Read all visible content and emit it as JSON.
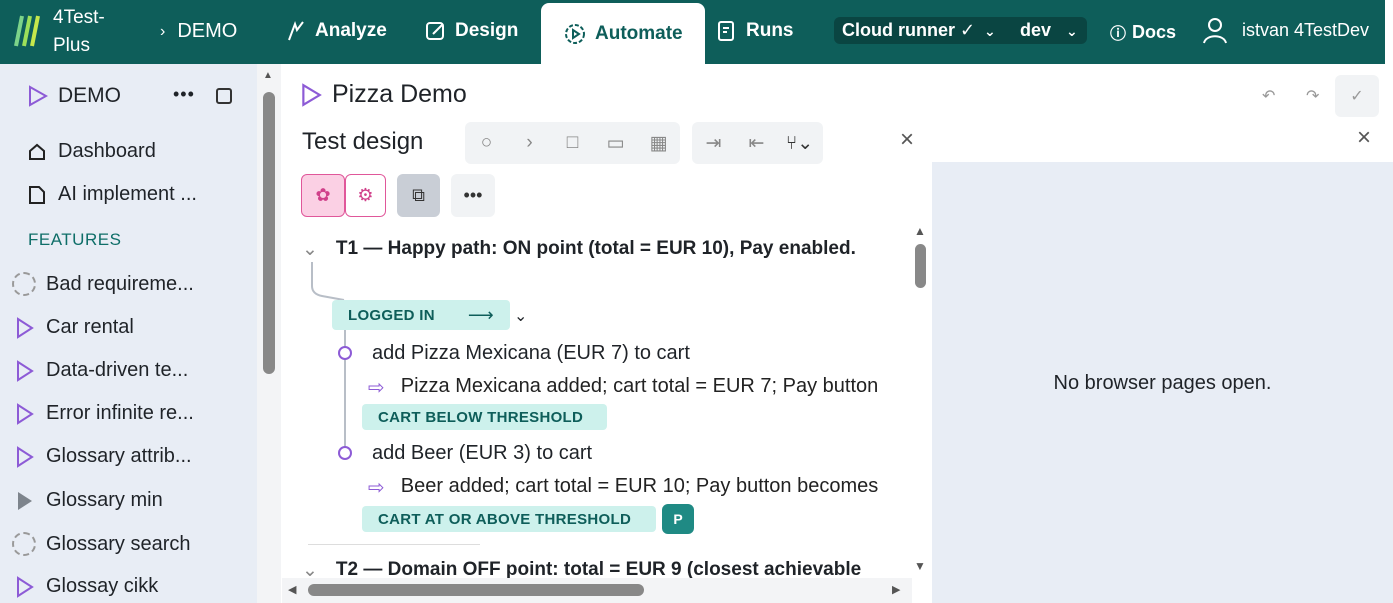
{
  "header": {
    "brand": "4Test-Plus",
    "crumb": "DEMO",
    "nav": [
      {
        "label": "Analyze",
        "icon": "analyze-icon"
      },
      {
        "label": "Design",
        "icon": "edit-icon"
      },
      {
        "label": "Automate",
        "icon": "automate-icon"
      },
      {
        "label": "Runs",
        "icon": "runs-icon"
      }
    ],
    "runner": "Cloud runner ✓",
    "env": "dev",
    "docs": "Docs",
    "user": "istvan 4TestDev"
  },
  "sidebar": {
    "project": "DEMO",
    "items": [
      "Dashboard",
      "AI implement ..."
    ],
    "section": "FEATURES",
    "features": [
      {
        "label": "Bad requireme...",
        "icon": "dashed-circle-icon"
      },
      {
        "label": "Car rental",
        "icon": "play-outline-icon"
      },
      {
        "label": "Data-driven te...",
        "icon": "play-outline-icon"
      },
      {
        "label": "Error infinite re...",
        "icon": "play-outline-icon"
      },
      {
        "label": "Glossary attrib...",
        "icon": "play-outline-icon"
      },
      {
        "label": "Glossary min",
        "icon": "play-filled-icon"
      },
      {
        "label": "Glossary search",
        "icon": "dashed-circle-icon"
      },
      {
        "label": "Glossay cikk",
        "icon": "play-outline-icon"
      }
    ]
  },
  "main": {
    "title": "Pizza Demo",
    "subtitle": "Test design",
    "tests": [
      {
        "title": "T1 — Happy path: ON point (total = EUR 10), Pay enabled."
      },
      {
        "title": "T2 — Domain OFF point: total = EUR 9 (closest achievable"
      }
    ],
    "states": [
      "LOGGED IN",
      "CART BELOW THRESHOLD",
      "CART AT OR ABOVE THRESHOLD"
    ],
    "steps": [
      "add Pizza Mexicana (EUR 7) to cart",
      "add Beer (EUR 3) to cart"
    ],
    "expects": [
      "Pizza Mexicana added; cart total = EUR 7; Pay button",
      "Beer added; cart total = EUR 10; Pay button becomes"
    ],
    "badge": "P"
  },
  "right": {
    "message": "No browser pages open."
  },
  "colors": {
    "header": "#0e5e5a",
    "sidebar": "#e8edf5",
    "state": "#cdf1ec",
    "accent": "#8d5bd6"
  }
}
